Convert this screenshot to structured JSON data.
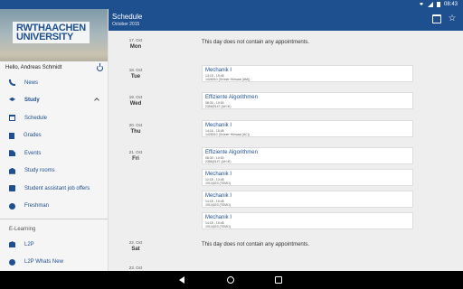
{
  "status": {
    "time": "08:43"
  },
  "drawer": {
    "logo_line1": "RWTHAACHEN",
    "logo_line2": "UNIVERSITY",
    "greeting": "Hello, Andreas Schmidt",
    "items": {
      "news": "News",
      "study": "Study",
      "schedule": "Schedule",
      "grades": "Grades",
      "events": "Events",
      "study_rooms": "Study rooms",
      "jobs": "Student assistant job offers",
      "freshman": "Freshman",
      "elearning": "E-Learning",
      "l2p": "L2P",
      "l2p_whats_new": "L2P Whats New"
    }
  },
  "appbar": {
    "title": "Schedule",
    "subtitle": "October 2015"
  },
  "days": [
    {
      "date": "17. Oct",
      "name": "Mon",
      "empty": "This day does not contain any appointments."
    },
    {
      "date": "18. Oct",
      "name": "Tue",
      "appointments": [
        {
          "title": "Mechanik I",
          "time": "13:15 - 15:45",
          "room": "1426010 (Grüner Hörsaal (AM))"
        }
      ]
    },
    {
      "date": "19. Oct",
      "name": "Wed",
      "appointments": [
        {
          "title": "Effiziente Algorithmen",
          "time": "08:30 - 10:00",
          "room": "2356|0147 (AH III)"
        }
      ]
    },
    {
      "date": "20. Oct",
      "name": "Thu",
      "appointments": [
        {
          "title": "Mechanik I",
          "time": "14:15 - 15:45",
          "room": "1426010 (Grüner Hörsaal (AC))"
        }
      ]
    },
    {
      "date": "21. Oct",
      "name": "Fri",
      "appointments": [
        {
          "title": "Effiziente Algorithmen",
          "time": "08:30 - 10:00",
          "room": "2356|0147 (AH III)"
        },
        {
          "title": "Mechanik I",
          "time": "12:15 - 13:45",
          "room": "1910|023 (TEMO)"
        },
        {
          "title": "Mechanik I",
          "time": "14:15 - 15:45",
          "room": "1910|023 (TEMO)"
        },
        {
          "title": "Mechanik I",
          "time": "14:15 - 15:45",
          "room": "1910|023 (TEMO)"
        }
      ]
    },
    {
      "date": "22. Oct",
      "name": "Sat",
      "empty": "This day does not contain any appointments."
    },
    {
      "date": "23. Oct",
      "name": ""
    }
  ],
  "colors": {
    "primary": "#1e4f8f",
    "background": "#eeeeee"
  },
  "icons": {
    "appbar": [
      "calendar-icon",
      "star-icon"
    ],
    "navbar": [
      "back-icon",
      "home-icon",
      "recents-icon"
    ]
  }
}
